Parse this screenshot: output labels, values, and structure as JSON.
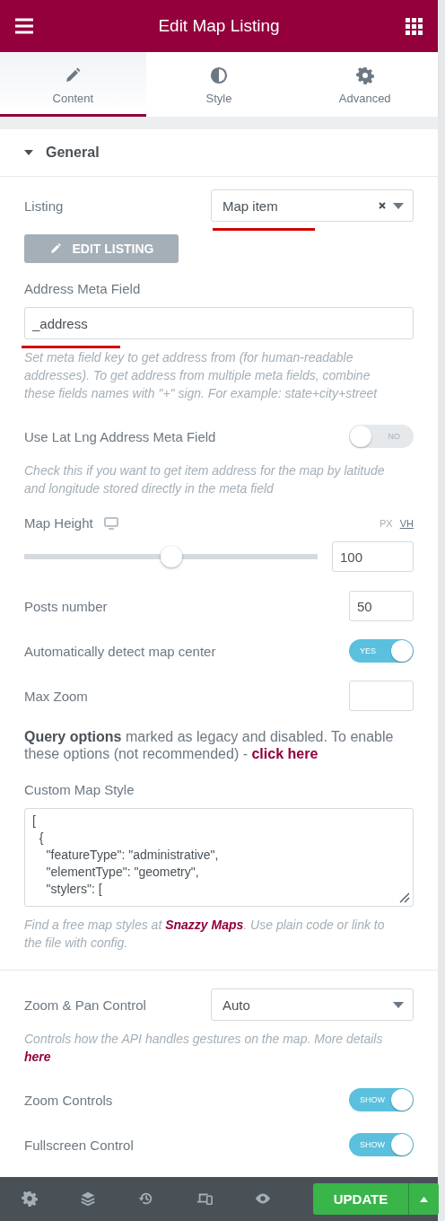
{
  "header": {
    "title": "Edit Map Listing"
  },
  "tabs": [
    {
      "label": "Content",
      "selected": true
    },
    {
      "label": "Style",
      "selected": false
    },
    {
      "label": "Advanced",
      "selected": false
    }
  ],
  "section": {
    "title": "General",
    "expanded": true
  },
  "controls": [
    {
      "kind": "select",
      "label": "Listing",
      "value": "Map item",
      "clearable": true,
      "annotated": true
    },
    {
      "kind": "button",
      "label": "EDIT LISTING",
      "disabled": true
    },
    {
      "kind": "text",
      "label": "Address Meta Field",
      "value": "_address",
      "annotated": true,
      "description": [
        {
          "kind": "text",
          "text": "Set meta field key to get address from (for human-readable addresses). To get address from multiple meta fields, combine these fields names with \"+\" sign. For example: state+city+street"
        }
      ]
    },
    {
      "kind": "switch",
      "label": "Use Lat Lng Address Meta Field",
      "on": false,
      "text": "NO",
      "description": [
        {
          "kind": "text",
          "text": "Check this if you want to get item address for the map by latitude and longitude stored directly in the meta field"
        }
      ]
    },
    {
      "kind": "slider",
      "label": "Map Height",
      "responsive": true,
      "units": [
        {
          "label": "PX",
          "selected": false
        },
        {
          "label": "VH",
          "selected": true
        }
      ],
      "level": 0.5,
      "value": "100"
    },
    {
      "kind": "number",
      "label": "Posts number",
      "value": "50"
    },
    {
      "kind": "switch",
      "label": "Automatically detect map center",
      "on": true,
      "text": "YES"
    },
    {
      "kind": "number",
      "label": "Max Zoom"
    },
    {
      "kind": "notice",
      "parts": [
        {
          "kind": "bold",
          "text": "Query options"
        },
        {
          "kind": "text",
          "text": " marked as legacy and disabled. To enable these options (not recommended) - "
        },
        {
          "kind": "link",
          "text": "click here"
        }
      ]
    },
    {
      "kind": "code",
      "label": "Custom Map Style",
      "lines": [
        "[",
        "  {",
        "    \"featureType\": \"administrative\",",
        "    \"elementType\": \"geometry\",",
        "    \"stylers\": ["
      ],
      "description": [
        {
          "kind": "text",
          "text": "Find a free map styles at "
        },
        {
          "kind": "link",
          "text": "Snazzy Maps"
        },
        {
          "kind": "text",
          "text": ". Use plain code or link to the file with config."
        }
      ]
    },
    {
      "kind": "divider"
    },
    {
      "kind": "select",
      "label": "Zoom & Pan Control",
      "value": "Auto",
      "clearable": false,
      "annotated": false,
      "description": [
        {
          "kind": "text",
          "text": "Controls how the API handles gestures on the map. More details "
        },
        {
          "kind": "link",
          "text": "here"
        }
      ]
    },
    {
      "kind": "switch",
      "label": "Zoom Controls",
      "on": true,
      "text": "SHOW"
    },
    {
      "kind": "switch",
      "label": "Fullscreen Control",
      "on": true,
      "text": "SHOW"
    }
  ],
  "footer": {
    "primary": "UPDATE"
  }
}
